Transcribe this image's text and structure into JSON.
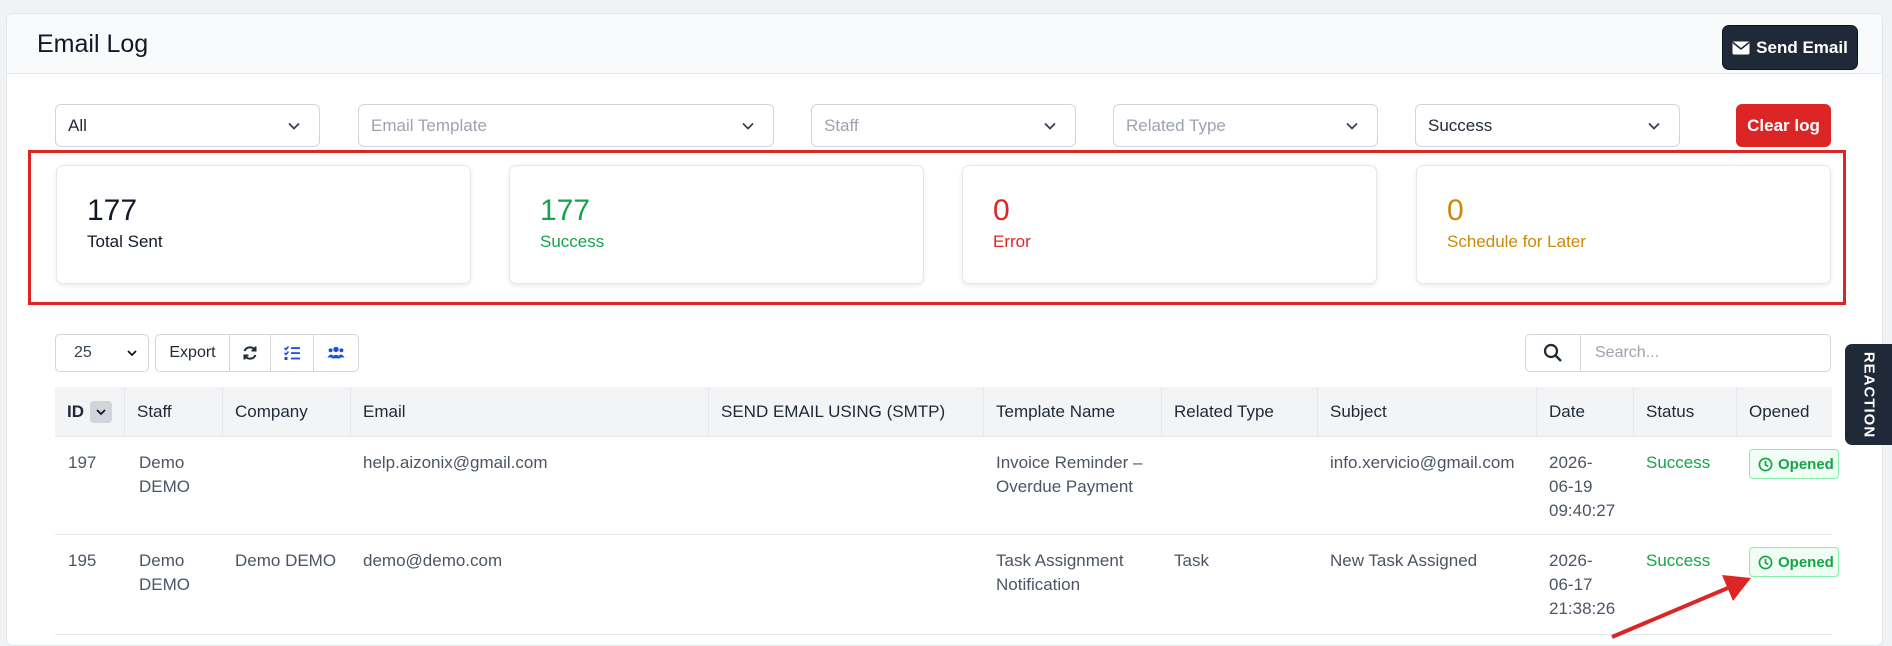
{
  "header": {
    "title": "Email Log",
    "send_button": "Send Email"
  },
  "filters": [
    {
      "value": "All",
      "placeholder": false
    },
    {
      "value": "Email Template",
      "placeholder": true
    },
    {
      "value": "Staff",
      "placeholder": true
    },
    {
      "value": "Related Type",
      "placeholder": true
    },
    {
      "value": "Success",
      "placeholder": false
    }
  ],
  "clear_button": "Clear log",
  "stats": [
    {
      "value": "177",
      "label": "Total Sent",
      "color": "#111827"
    },
    {
      "value": "177",
      "label": "Success",
      "color": "#16a34a"
    },
    {
      "value": "0",
      "label": "Error",
      "color": "#dc2626"
    },
    {
      "value": "0",
      "label": "Schedule for Later",
      "color": "#ca8a04"
    }
  ],
  "toolbar": {
    "page_length": "25",
    "export_label": "Export",
    "search_placeholder": "Search..."
  },
  "table": {
    "columns": [
      "ID",
      "Staff",
      "Company",
      "Email",
      "SEND EMAIL USING (SMTP)",
      "Template Name",
      "Related Type",
      "Subject",
      "Date",
      "Status",
      "Opened"
    ],
    "rows": [
      {
        "id": "197",
        "staff": [
          "Demo",
          "DEMO"
        ],
        "company": "",
        "email": "help.aizonix@gmail.com",
        "smtp": "",
        "template": [
          "Invoice Reminder –",
          "Overdue Payment"
        ],
        "related_type": "",
        "subject": "info.xervicio@gmail.com",
        "date": [
          "2026-",
          "06-19",
          "09:40:27"
        ],
        "status": "Success",
        "opened": "Opened"
      },
      {
        "id": "195",
        "staff": [
          "Demo",
          "DEMO"
        ],
        "company": "Demo DEMO",
        "email": "demo@demo.com",
        "smtp": "",
        "template": [
          "Task Assignment",
          "Notification"
        ],
        "related_type": "Task",
        "subject": "New Task Assigned",
        "date": [
          "2026-",
          "06-17",
          "21:38:26"
        ],
        "status": "Success",
        "opened": "Opened"
      }
    ]
  },
  "side_tab": "REACTION"
}
